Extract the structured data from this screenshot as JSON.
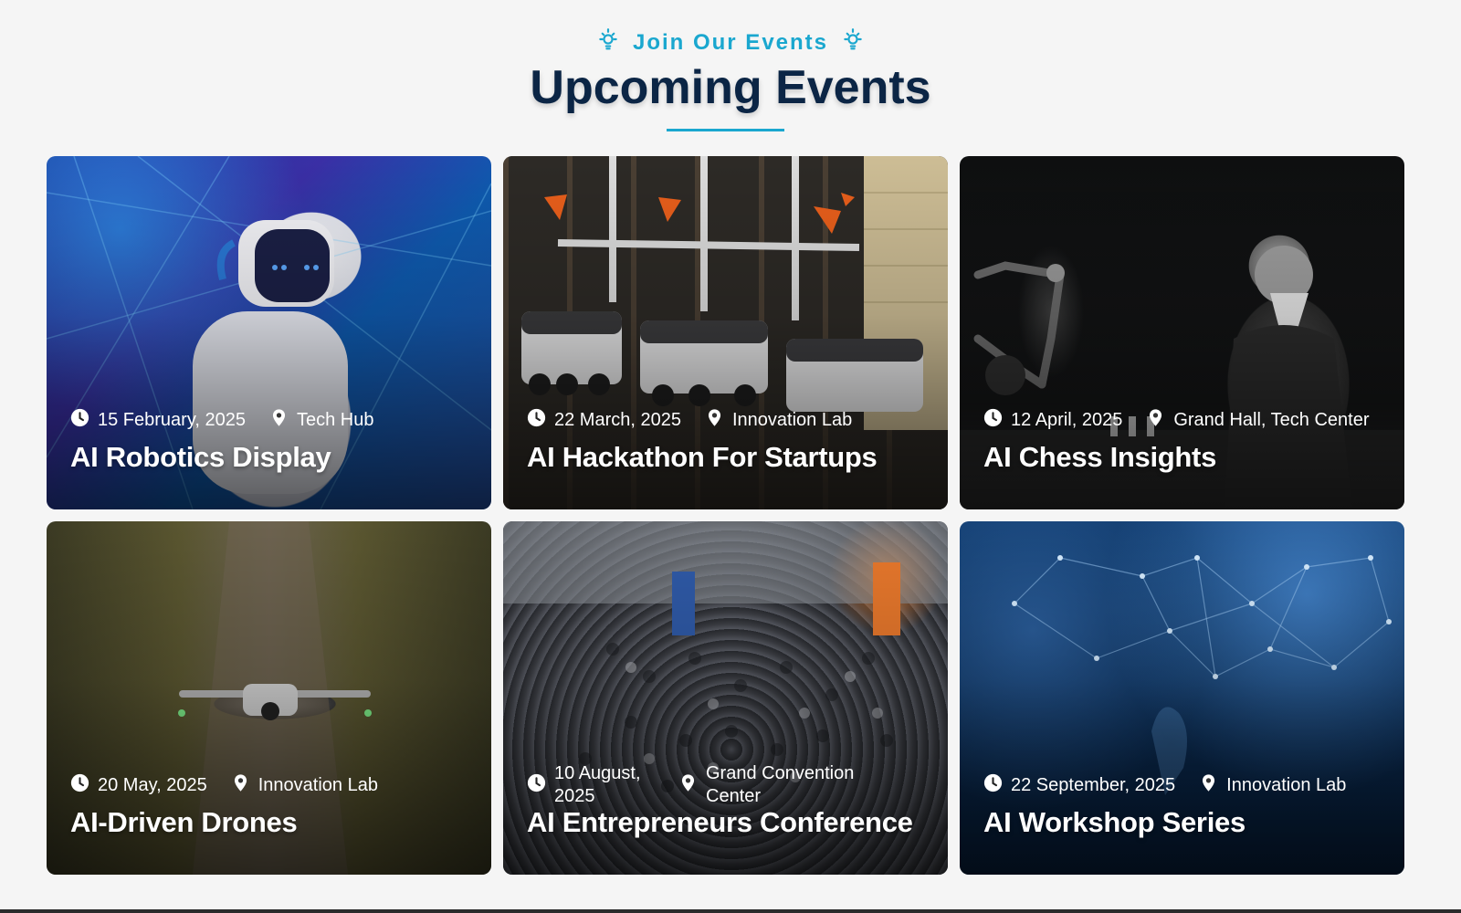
{
  "header": {
    "tagline": "Join Our Events",
    "title": "Upcoming Events",
    "accent_color": "#1aa7cf",
    "title_color": "#0b2545",
    "icon": "lightbulb-icon"
  },
  "events": [
    {
      "date": "15 February, 2025",
      "location": "Tech Hub",
      "title": "AI Robotics Display"
    },
    {
      "date": "22 March, 2025",
      "location": "Innovation Lab",
      "title": "AI Hackathon For Startups"
    },
    {
      "date": "12 April, 2025",
      "location": "Grand Hall, Tech Center",
      "title": "AI Chess Insights"
    },
    {
      "date": "20 May, 2025",
      "location": "Innovation Lab",
      "title": "AI-Driven Drones"
    },
    {
      "date": "10 August, 2025",
      "location": "Grand Convention Center",
      "title": "AI Entrepreneurs Conference"
    },
    {
      "date": "22 September, 2025",
      "location": "Innovation Lab",
      "title": "AI Workshop Series"
    }
  ],
  "icons": {
    "date": "clock-icon",
    "location": "map-pin-icon"
  }
}
